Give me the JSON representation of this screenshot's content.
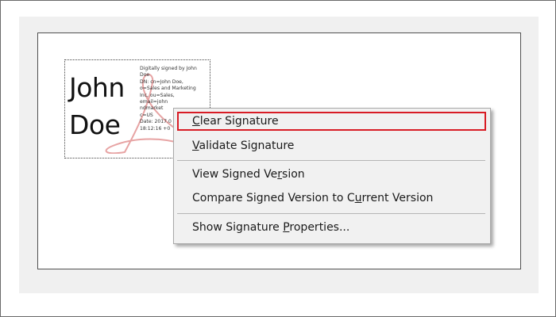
{
  "signature": {
    "first_name": "John",
    "last_name": "Doe",
    "details": [
      "Digitally signed by John",
      "Doe",
      "DN: cn=John Doe,",
      "o=Sales and Marketing",
      "Inc, ou=Sales,",
      "email=john",
      "ndmarket",
      "c=US",
      "Date: 2017.0",
      "18:12:16 +0"
    ],
    "logo": "acrobat-logo-watermark"
  },
  "context_menu": {
    "items": [
      {
        "pre": "",
        "accel": "C",
        "post": "lear Signature"
      },
      {
        "pre": "",
        "accel": "V",
        "post": "alidate Signature"
      },
      {
        "pre": "View Signed Ve",
        "accel": "r",
        "post": "sion"
      },
      {
        "pre": "Compare Signed Version to C",
        "accel": "u",
        "post": "rrent Version"
      },
      {
        "pre": "Show Signature ",
        "accel": "P",
        "post": "roperties..."
      }
    ]
  },
  "colors": {
    "highlight_border": "#d81c25",
    "menu_background": "#f1f1f1"
  }
}
